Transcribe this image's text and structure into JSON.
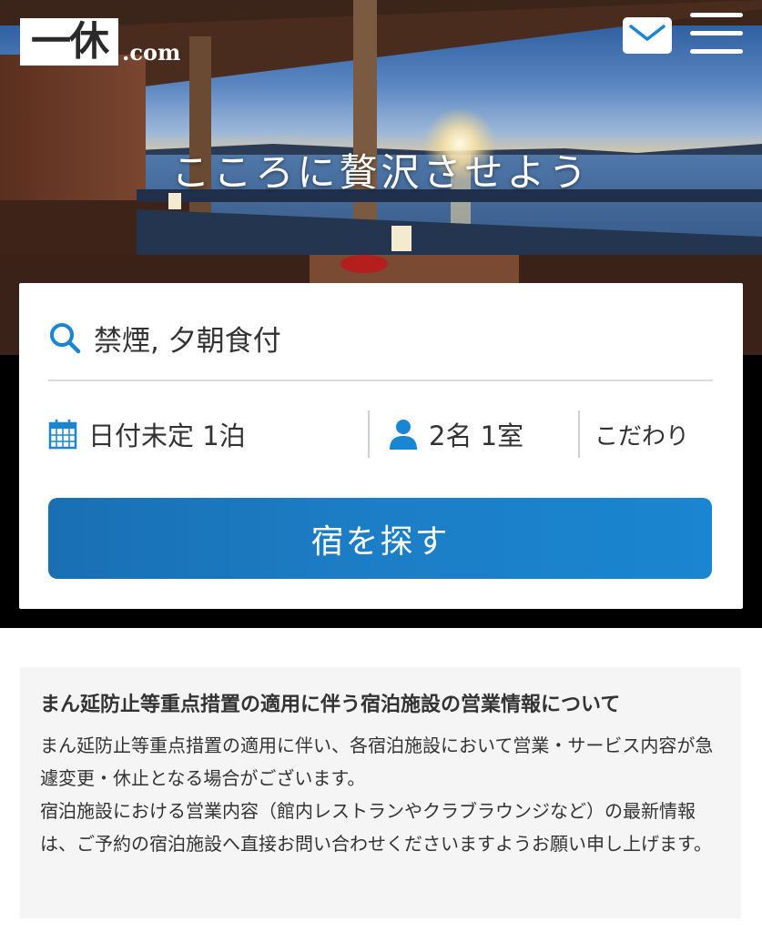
{
  "header": {
    "logo_mark": "一休",
    "logo_suffix": ".com",
    "mail_icon": "mail-icon",
    "menu_icon": "hamburger-menu-icon"
  },
  "hero": {
    "tagline": "こころに贅沢させよう"
  },
  "search": {
    "keyword_icon": "search-icon",
    "keyword_value": "禁煙, 夕朝食付",
    "date_icon": "calendar-icon",
    "date_value": "日付未定 1泊",
    "guest_icon": "person-icon",
    "guest_value": "2名 1室",
    "preferences_label": "こだわり",
    "submit_label": "宿を探す"
  },
  "notice": {
    "title": "まん延防止等重点措置の適用に伴う宿泊施設の営業情報について",
    "paragraph1": "まん延防止等重点措置の適用に伴い、各宿泊施設において営業・サービス内容が急遽変更・休止となる場合がございます。",
    "paragraph2": "宿泊施設における営業内容（館内レストランやクラブラウンジなど）の最新情報は、ご予約の宿泊施設へ直接お問い合わせくださいますようお願い申し上げます。"
  },
  "colors": {
    "accent_blue": "#1c7ec6",
    "icon_blue": "#1a85d0",
    "notice_bg": "#f5f5f5"
  }
}
